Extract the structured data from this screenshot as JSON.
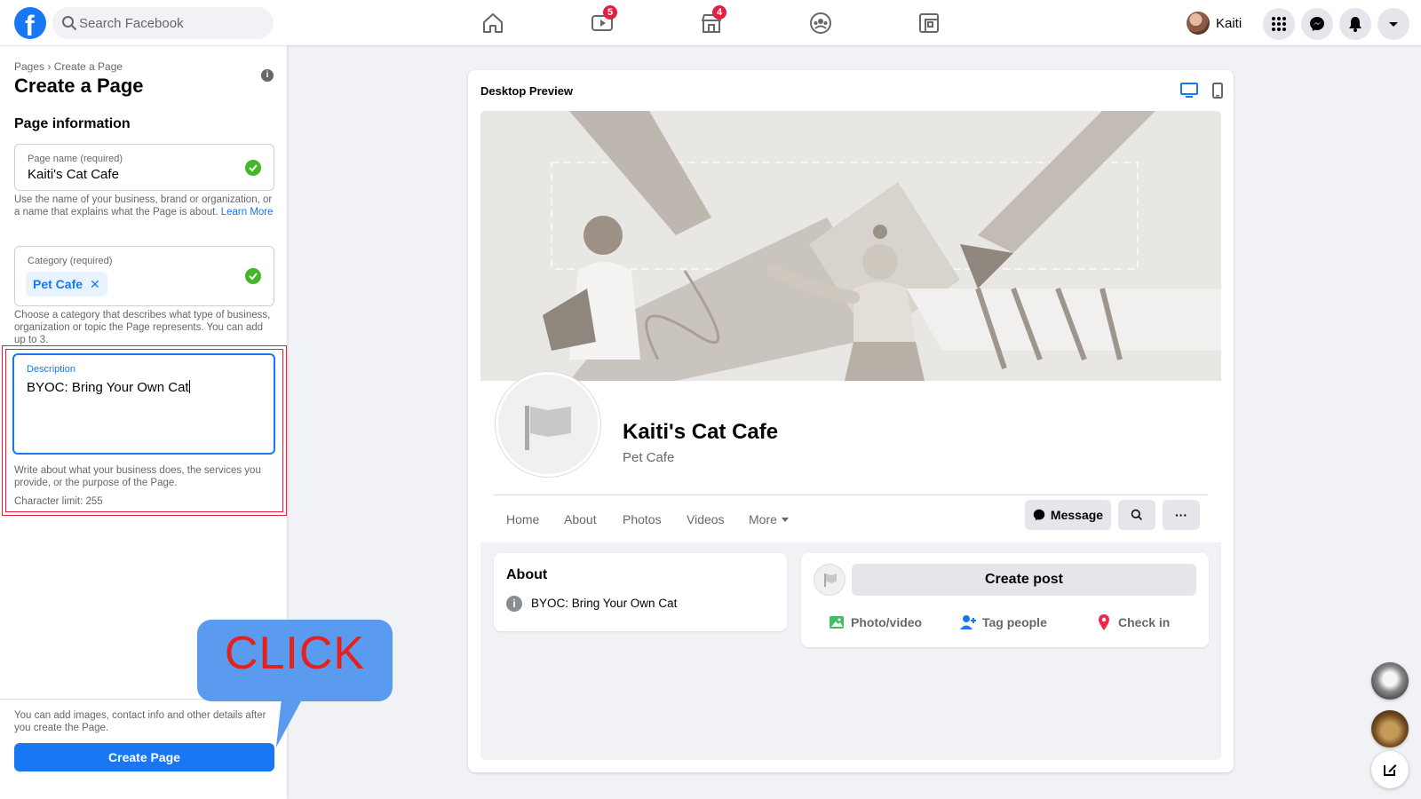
{
  "header": {
    "search_placeholder": "Search Facebook",
    "video_badge": "5",
    "marketplace_badge": "4",
    "profile_name": "Kaiti"
  },
  "left_panel": {
    "breadcrumb": "Pages › Create a Page",
    "title": "Create a Page",
    "info_icon_label": "i",
    "section_title": "Page information",
    "page_name": {
      "label": "Page name (required)",
      "value": "Kaiti's Cat Cafe",
      "helper": "Use the name of your business, brand or organization, or a name that explains what the Page is about.",
      "helper_link": "Learn More"
    },
    "category": {
      "label": "Category (required)",
      "chip": "Pet Cafe",
      "chip_remove": "✕",
      "helper": "Choose a category that describes what type of business, organization or topic the Page represents. You can add up to 3."
    },
    "description": {
      "label": "Description",
      "value": "BYOC: Bring Your Own Cat",
      "helper": "Write about what your business does, the services you provide, or the purpose of the Page.",
      "char_limit": "Character limit: 255"
    },
    "footer_note": "You can add images, contact info and other details after you create the Page.",
    "create_button": "Create Page"
  },
  "callout": {
    "text": "CLICK"
  },
  "preview": {
    "title": "Desktop Preview",
    "page_name": "Kaiti's Cat Cafe",
    "page_category": "Pet Cafe",
    "tabs": [
      "Home",
      "About",
      "Photos",
      "Videos",
      "More"
    ],
    "message_button": "Message",
    "more_button": "···",
    "about_title": "About",
    "about_icon_label": "i",
    "about_text": "BYOC: Bring Your Own Cat",
    "create_post": "Create post",
    "actions": [
      "Photo/video",
      "Tag people",
      "Check in"
    ]
  },
  "colors": {
    "brand_blue": "#1877f2",
    "badge_red": "#e41e3f",
    "check_green": "#42b72a",
    "callout_blue": "#5a9bf0",
    "callout_text_red": "#e8201a"
  }
}
